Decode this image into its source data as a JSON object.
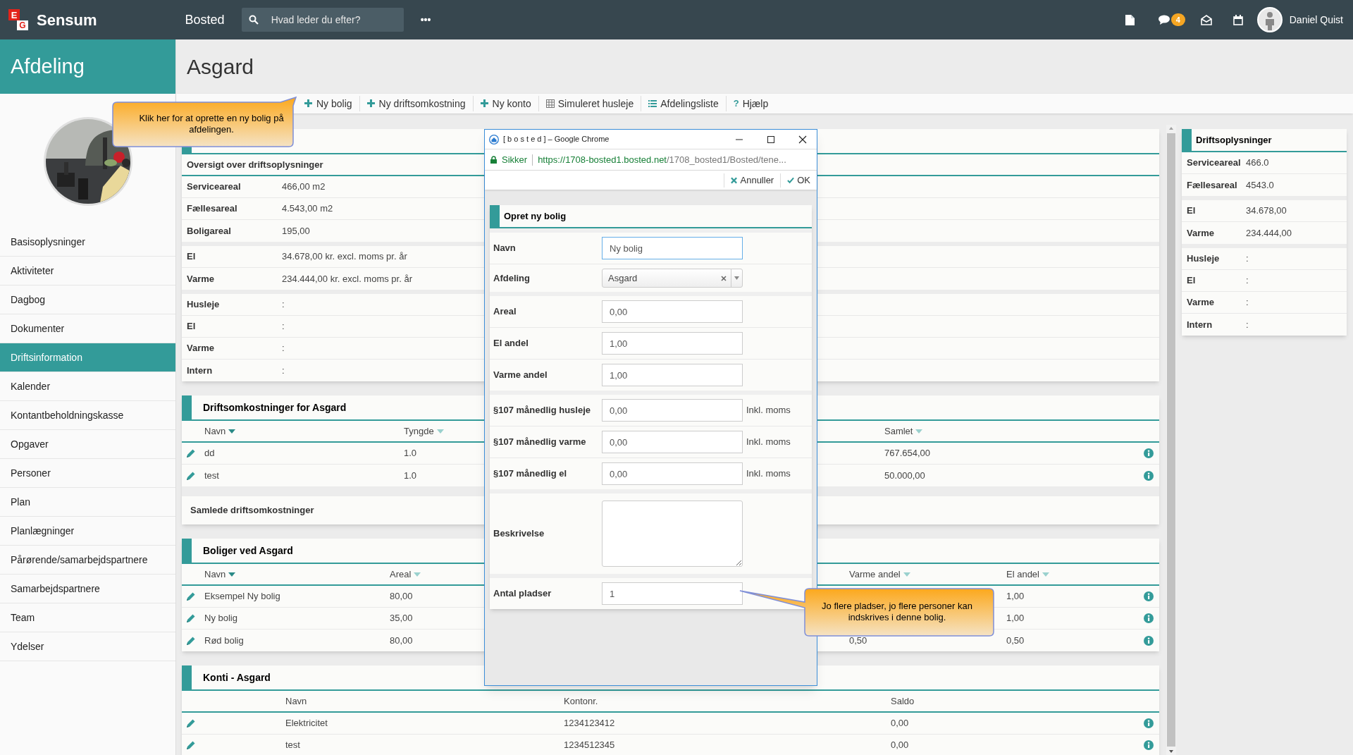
{
  "topbar": {
    "logo_letters": [
      "E",
      "G"
    ],
    "brand": "Sensum",
    "module": "Bosted",
    "search": {
      "placeholder": "Hvad leder du efter?"
    },
    "more": "•••",
    "message_count": "4",
    "user": "Daniel Quist"
  },
  "sidebar": {
    "title": "Afdeling",
    "items": [
      {
        "label": "Basisoplysninger",
        "selected": false
      },
      {
        "label": "Aktiviteter",
        "selected": false
      },
      {
        "label": "Dagbog",
        "selected": false
      },
      {
        "label": "Dokumenter",
        "selected": false
      },
      {
        "label": "Driftsinformation",
        "selected": true
      },
      {
        "label": "Kalender",
        "selected": false
      },
      {
        "label": "Kontantbeholdningskasse",
        "selected": false
      },
      {
        "label": "Opgaver",
        "selected": false
      },
      {
        "label": "Personer",
        "selected": false
      },
      {
        "label": "Plan",
        "selected": false
      },
      {
        "label": "Planlægninger",
        "selected": false
      },
      {
        "label": "Pårørende/samarbejdspartnere",
        "selected": false
      },
      {
        "label": "Samarbejdspartnere",
        "selected": false
      },
      {
        "label": "Team",
        "selected": false
      },
      {
        "label": "Ydelser",
        "selected": false
      }
    ]
  },
  "page": {
    "title": "Asgard"
  },
  "toolbar": [
    {
      "label": "Ny bolig",
      "kind": "plus"
    },
    {
      "label": "Ny driftsomkostning",
      "kind": "plus"
    },
    {
      "label": "Ny konto",
      "kind": "plus"
    },
    {
      "label": "Simuleret husleje",
      "kind": "calculator"
    },
    {
      "label": "Afdelingsliste",
      "kind": "list"
    },
    {
      "label": "Hjælp",
      "kind": "help",
      "glyph": "?"
    }
  ],
  "overview": {
    "heading": "Oversigt over driftsoplysninger",
    "groups": [
      [
        {
          "label": "Serviceareal",
          "value": "466,00 m2"
        },
        {
          "label": "Fællesareal",
          "value": "4.543,00 m2"
        },
        {
          "label": "Boligareal",
          "value": "195,00"
        }
      ],
      [
        {
          "label": "El",
          "value": "34.678,00 kr. excl. moms pr. år"
        },
        {
          "label": "Varme",
          "value": "234.444,00 kr. excl. moms pr. år"
        }
      ],
      [
        {
          "label": "Husleje",
          "value": ":"
        },
        {
          "label": "El",
          "value": ":"
        },
        {
          "label": "Varme",
          "value": ":"
        },
        {
          "label": "Intern",
          "value": ":"
        }
      ]
    ]
  },
  "costs": {
    "title": "Driftsomkostninger for Asgard",
    "columns": [
      {
        "label": "Navn",
        "sorted": true
      },
      {
        "label": "Tyngde",
        "sorted": false
      },
      {
        "label": "Samlet",
        "sorted": false
      }
    ],
    "rows": [
      {
        "name": "dd",
        "weight": "1.0",
        "total": "767.654,00"
      },
      {
        "name": "test",
        "weight": "1.0",
        "total": "50.000,00"
      }
    ],
    "total_label": "Samlede driftsomkostninger"
  },
  "housing": {
    "title": "Boliger ved Asgard",
    "columns": [
      {
        "label": "Navn",
        "sorted": true
      },
      {
        "label": "Areal",
        "sorted": false
      },
      {
        "label": "Varme andel",
        "sorted": false
      },
      {
        "label": "El andel",
        "sorted": false
      }
    ],
    "rows": [
      {
        "name": "Eksempel Ny bolig",
        "area": "80,00",
        "el_share": "1,00"
      },
      {
        "name": "Ny bolig",
        "area": "35,00",
        "el_share": "1,00"
      },
      {
        "name": "Rød bolig",
        "area": "80,00",
        "heat_share": "0,50",
        "el_share": "0,50"
      }
    ]
  },
  "accounts": {
    "title": "Konti - Asgard",
    "columns": [
      "Navn",
      "Kontonr.",
      "Saldo"
    ],
    "rows": [
      {
        "name": "Elektricitet",
        "number": "1234123412",
        "balance": "0,00"
      },
      {
        "name": "test",
        "number": "1234512345",
        "balance": "0,00"
      }
    ]
  },
  "right_panel": {
    "title": "Driftsoplysninger",
    "groups": [
      [
        {
          "label": "Serviceareal",
          "value": "466.0"
        },
        {
          "label": "Fællesareal",
          "value": "4543.0"
        }
      ],
      [
        {
          "label": "El",
          "value": "34.678,00"
        },
        {
          "label": "Varme",
          "value": "234.444,00"
        }
      ],
      [
        {
          "label": "Husleje",
          "value": ":"
        },
        {
          "label": "El",
          "value": ":"
        },
        {
          "label": "Varme",
          "value": ":"
        },
        {
          "label": "Intern",
          "value": ":"
        }
      ]
    ]
  },
  "popup": {
    "title": "[ b o s t e d ] – Google Chrome",
    "secure_label": "Sikker",
    "url_host": "https://1708-bosted1.bosted.net",
    "url_path": "/1708_bosted1/Bosted/tene...",
    "actions": [
      {
        "label": "Annuller",
        "kind": "cancel"
      },
      {
        "label": "OK",
        "kind": "ok"
      }
    ],
    "form": {
      "title": "Opret ny bolig",
      "groups": [
        [
          {
            "label": "Navn",
            "kind": "input",
            "value": "Ny bolig",
            "focused": true
          },
          {
            "label": "Afdeling",
            "kind": "select",
            "value": "Asgard",
            "focused": false
          }
        ],
        [
          {
            "label": "Areal",
            "kind": "input",
            "value": "0,00",
            "focused": false
          },
          {
            "label": "El andel",
            "kind": "input",
            "value": "1,00",
            "focused": false
          },
          {
            "label": "Varme andel",
            "kind": "input",
            "value": "1,00",
            "focused": false
          }
        ],
        [
          {
            "label": "§107 månedlig husleje",
            "kind": "input",
            "value": "0,00",
            "suffix": "Inkl. moms",
            "focused": false
          },
          {
            "label": "§107 månedlig varme",
            "kind": "input",
            "value": "0,00",
            "suffix": "Inkl. moms",
            "focused": false
          },
          {
            "label": "§107 månedlig el",
            "kind": "input",
            "value": "0,00",
            "suffix": "Inkl. moms",
            "focused": false
          }
        ],
        [
          {
            "label": "Beskrivelse",
            "kind": "textarea",
            "focused": false
          }
        ],
        [
          {
            "label": "Antal pladser",
            "kind": "input",
            "value": "1",
            "focused": false
          }
        ]
      ]
    }
  },
  "callouts": [
    {
      "text": "Klik her for at oprette en ny bolig på afdelingen.",
      "kind": "up-right"
    },
    {
      "text": "Jo flere pladser, jo flere personer kan indskrives i denne bolig.",
      "kind": "left"
    }
  ]
}
